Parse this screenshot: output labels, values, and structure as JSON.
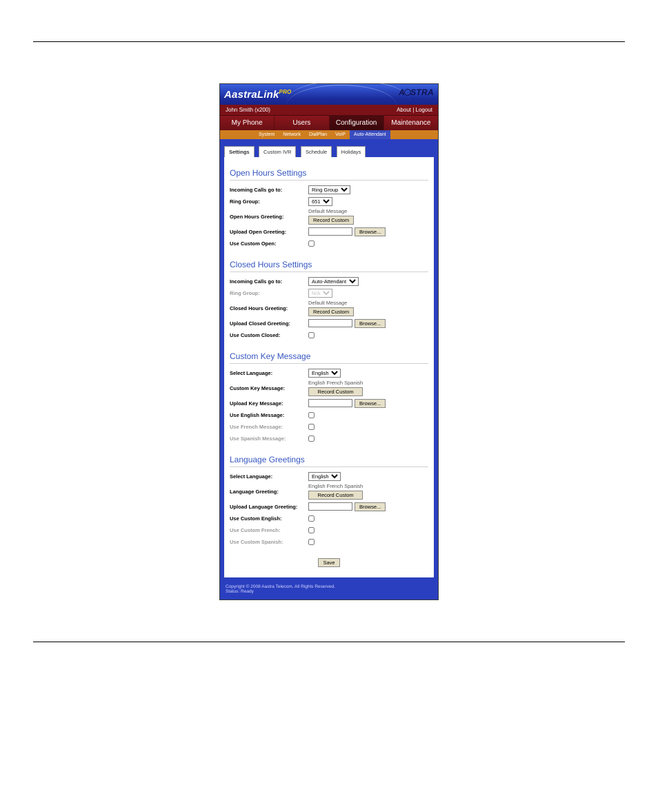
{
  "banner": {
    "title_main": "AastraLink",
    "title_sup": "PRO",
    "brand_right": "AASTRA"
  },
  "userrow": {
    "left": "John Smith (x200)",
    "right": "About | Logout"
  },
  "mainnav": {
    "items": [
      {
        "label": "My Phone"
      },
      {
        "label": "Users"
      },
      {
        "label": "Configuration"
      },
      {
        "label": "Maintenance"
      }
    ],
    "active_index": 2
  },
  "subnav": {
    "items": [
      {
        "label": "System"
      },
      {
        "label": "Network"
      },
      {
        "label": "DialPlan"
      },
      {
        "label": "VoIP"
      },
      {
        "label": "Auto-Attendant"
      }
    ],
    "active_index": 4
  },
  "innertabs": {
    "items": [
      {
        "label": "Settings"
      },
      {
        "label": "Custom IVR"
      },
      {
        "label": "Schedule"
      },
      {
        "label": "Holidays"
      }
    ],
    "active_index": 0
  },
  "sections": {
    "open": {
      "heading": "Open Hours Settings",
      "incoming_label": "Incoming Calls go to:",
      "incoming_value": "Ring Group",
      "ringgroup_label": "Ring Group:",
      "ringgroup_value": "651",
      "greeting_label": "Open Hours Greeting:",
      "greeting_default": "Default Message",
      "record_btn": "Record Custom",
      "upload_label": "Upload Open Greeting:",
      "browse_btn": "Browse...",
      "usecustom_label": "Use Custom Open:"
    },
    "closed": {
      "heading": "Closed Hours Settings",
      "incoming_label": "Incoming Calls go to:",
      "incoming_value": "Auto-Attendant",
      "ringgroup_label": "Ring Group:",
      "ringgroup_value": "N/A",
      "greeting_label": "Closed Hours Greeting:",
      "greeting_default": "Default Message",
      "record_btn": "Record Custom",
      "upload_label": "Upload Closed Greeting:",
      "browse_btn": "Browse...",
      "usecustom_label": "Use Custom Closed:"
    },
    "customkey": {
      "heading": "Custom Key Message",
      "lang_label": "Select Language:",
      "lang_value": "English",
      "msg_label": "Custom Key Message:",
      "msg_default": "English French Spanish",
      "record_btn": "Record Custom",
      "upload_label": "Upload Key Message:",
      "browse_btn": "Browse...",
      "use_en_label": "Use English Message:",
      "use_fr_label": "Use French Message:",
      "use_es_label": "Use Spanish Message:"
    },
    "langgreet": {
      "heading": "Language Greetings",
      "lang_label": "Select Language:",
      "lang_value": "English",
      "greet_label": "Language Greeting:",
      "greet_default": "English French Spanish",
      "record_btn": "Record Custom",
      "upload_label": "Upload Language Greeting:",
      "browse_btn": "Browse...",
      "use_en_label": "Use Custom English:",
      "use_fr_label": "Use Custom French:",
      "use_es_label": "Use Custom Spanish:"
    }
  },
  "save_btn": "Save",
  "footer": {
    "line1": "Copyright © 2008 Aastra Telecom. All Rights Reserved.",
    "line2": "Status: Ready"
  }
}
